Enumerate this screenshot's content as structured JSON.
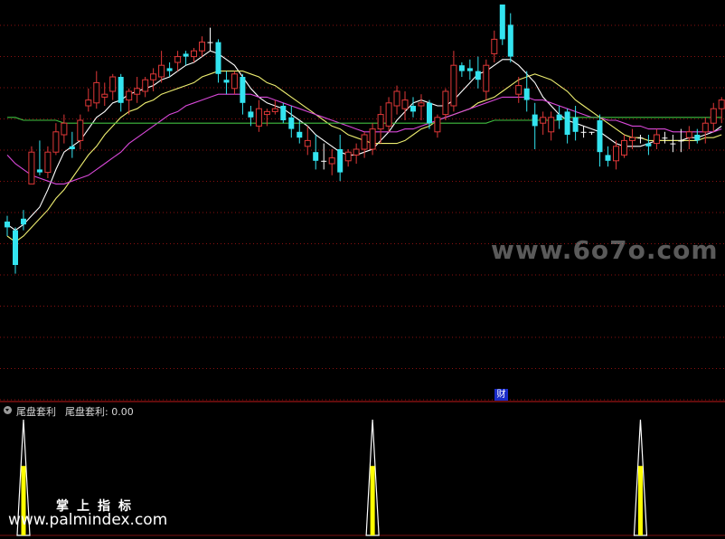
{
  "watermarks": {
    "site_6070": "www.6o7o.com",
    "brand_cn": "掌上指标",
    "url": "www.palmindex.com"
  },
  "badge": {
    "cai": "财"
  },
  "indicator": {
    "title": "尾盘套利",
    "value_label": "尾盘套利: 0.00"
  },
  "colors": {
    "background": "#000000",
    "grid": "#8a1010",
    "up": "#e03838",
    "down": "#33e4f0",
    "flat": "#ffffff",
    "ma5": "#ffffff",
    "ma10": "#eded70",
    "ma20": "#d848d8",
    "ma60": "#40c040",
    "signal_fill": "#ffff00",
    "signal_outline": "#ffffff"
  },
  "chart_data": [
    {
      "type": "candlestick",
      "title": "",
      "price_range": [
        0,
        100
      ],
      "grid": true,
      "series": [
        {
          "name": "",
          "key": "ma5"
        },
        {
          "name": "",
          "key": "ma10"
        },
        {
          "name": "",
          "key": "ma20"
        },
        {
          "name": "",
          "key": "ma60"
        }
      ],
      "ohlc": [
        [
          25,
          27,
          20,
          23
        ],
        [
          22,
          23,
          7,
          10
        ],
        [
          26,
          29,
          22,
          24
        ],
        [
          38,
          51,
          38,
          49
        ],
        [
          43,
          53,
          41,
          42
        ],
        [
          42,
          51,
          40,
          49
        ],
        [
          49,
          59,
          48,
          56
        ],
        [
          55,
          62,
          52,
          59
        ],
        [
          51,
          56,
          47,
          50
        ],
        [
          53,
          62,
          50,
          60
        ],
        [
          65,
          71,
          63,
          67
        ],
        [
          66,
          77,
          64,
          73
        ],
        [
          68,
          73,
          65,
          69
        ],
        [
          70,
          76,
          67,
          75
        ],
        [
          75,
          76,
          63,
          66
        ],
        [
          67,
          71,
          62,
          70
        ],
        [
          69,
          75,
          66,
          71
        ],
        [
          70,
          75,
          68,
          74
        ],
        [
          74,
          78,
          70,
          76
        ],
        [
          75,
          84,
          73,
          79
        ],
        [
          78,
          80,
          75,
          77
        ],
        [
          80,
          84,
          77,
          82
        ],
        [
          83,
          84,
          79,
          82
        ],
        [
          82,
          85,
          80,
          84
        ],
        [
          84,
          89,
          82,
          87
        ],
        [
          87,
          92,
          84,
          87
        ],
        [
          87,
          88,
          73,
          76
        ],
        [
          74,
          77,
          69,
          73
        ],
        [
          71,
          77,
          69,
          76
        ],
        [
          75,
          76,
          62,
          66
        ],
        [
          63,
          65,
          58,
          61
        ],
        [
          58,
          67,
          56,
          64
        ],
        [
          62,
          64,
          58,
          63
        ],
        [
          63,
          67,
          62,
          64
        ],
        [
          65,
          66,
          59,
          60
        ],
        [
          61,
          65,
          54,
          57
        ],
        [
          56,
          60,
          52,
          54
        ],
        [
          51,
          58,
          48,
          53
        ],
        [
          49,
          55,
          43,
          46
        ],
        [
          46,
          52,
          43,
          46
        ],
        [
          45,
          50,
          41,
          47
        ],
        [
          50,
          55,
          39,
          42
        ],
        [
          46,
          50,
          44,
          49
        ],
        [
          48,
          52,
          45,
          50
        ],
        [
          50,
          56,
          47,
          55
        ],
        [
          50,
          59,
          48,
          57
        ],
        [
          57,
          65,
          52,
          62
        ],
        [
          58,
          68,
          56,
          66
        ],
        [
          65,
          72,
          62,
          70
        ],
        [
          64,
          70,
          60,
          67
        ],
        [
          65,
          68,
          61,
          63
        ],
        [
          65,
          69,
          60,
          66
        ],
        [
          66,
          67,
          57,
          59
        ],
        [
          56,
          62,
          54,
          61
        ],
        [
          62,
          71,
          60,
          70
        ],
        [
          65,
          84,
          63,
          79
        ],
        [
          79,
          80,
          75,
          77
        ],
        [
          78,
          81,
          74,
          77
        ],
        [
          77,
          82,
          71,
          74
        ],
        [
          70,
          81,
          67,
          79
        ],
        [
          83,
          91,
          80,
          88
        ],
        [
          100,
          100,
          86,
          88
        ],
        [
          93,
          97,
          80,
          82
        ],
        [
          69,
          75,
          66,
          72
        ],
        [
          71,
          77,
          63,
          67
        ],
        [
          62,
          66,
          50,
          58
        ],
        [
          59,
          63,
          55,
          61
        ],
        [
          56,
          63,
          53,
          61
        ],
        [
          62,
          65,
          57,
          60
        ],
        [
          63,
          64,
          52,
          55
        ],
        [
          61,
          65,
          53,
          56
        ],
        [
          56,
          58,
          54,
          56
        ],
        [
          56,
          56,
          55,
          56
        ],
        [
          60,
          62,
          44,
          49
        ],
        [
          48,
          51,
          44,
          46
        ],
        [
          46,
          53,
          43,
          51
        ],
        [
          48,
          55,
          47,
          53
        ],
        [
          53,
          57,
          50,
          54
        ],
        [
          54,
          55,
          52,
          54
        ],
        [
          52,
          55,
          48,
          51
        ],
        [
          52,
          57,
          50,
          55
        ],
        [
          54,
          56,
          52,
          54
        ],
        [
          52,
          55,
          49,
          52
        ],
        [
          53,
          57,
          49,
          53
        ],
        [
          54,
          58,
          50,
          56
        ],
        [
          55,
          57,
          52,
          53
        ],
        [
          56,
          61,
          52,
          59
        ],
        [
          59,
          66,
          56,
          64
        ],
        [
          64,
          68,
          59,
          67
        ]
      ],
      "ma5": [
        24,
        22,
        24,
        27,
        30,
        36,
        43,
        49,
        51,
        53,
        57,
        61,
        63,
        66,
        67,
        69,
        70,
        71,
        72,
        74,
        75,
        77,
        79,
        80,
        82,
        84,
        83,
        81,
        79,
        75,
        71,
        68,
        66,
        65,
        64,
        62,
        60,
        58,
        55,
        53,
        51,
        49,
        48,
        48,
        49,
        50,
        53,
        56,
        60,
        63,
        66,
        67,
        66,
        65,
        65,
        67,
        70,
        73,
        76,
        77,
        79,
        81,
        81,
        79,
        76,
        73,
        68,
        65,
        62,
        60,
        59,
        58,
        57,
        56,
        54,
        52,
        51,
        51,
        51,
        52,
        53,
        53,
        53,
        53,
        54,
        54,
        55,
        56,
        58
      ],
      "ma10": [
        20,
        18,
        20,
        23,
        26,
        29,
        33,
        36,
        40,
        44,
        48,
        51,
        55,
        58,
        61,
        63,
        64,
        66,
        67,
        69,
        70,
        71,
        72,
        73,
        75,
        76,
        77,
        77,
        77,
        77,
        76,
        75,
        73,
        72,
        70,
        68,
        66,
        64,
        62,
        60,
        58,
        57,
        55,
        54,
        53,
        52,
        52,
        52,
        52,
        53,
        55,
        57,
        58,
        60,
        61,
        62,
        63,
        64,
        66,
        67,
        68,
        70,
        72,
        74,
        75,
        76,
        75,
        74,
        72,
        70,
        67,
        65,
        63,
        61,
        59,
        57,
        55,
        54,
        54,
        53,
        53,
        53,
        53,
        53,
        53,
        53,
        54,
        54,
        55
      ],
      "ma20": [
        48,
        45,
        43,
        41,
        40,
        39,
        38,
        38,
        39,
        40,
        41,
        43,
        45,
        47,
        49,
        52,
        54,
        56,
        58,
        60,
        62,
        63,
        65,
        66,
        67,
        68,
        69,
        69,
        69,
        69,
        69,
        68,
        68,
        67,
        66,
        65,
        64,
        63,
        62,
        61,
        60,
        59,
        58,
        57,
        56,
        56,
        56,
        56,
        56,
        57,
        57,
        58,
        59,
        60,
        61,
        62,
        63,
        64,
        65,
        66,
        67,
        68,
        68,
        68,
        68,
        67,
        67,
        66,
        65,
        64,
        63,
        62,
        61,
        61,
        60,
        60,
        59,
        58,
        58,
        57,
        57,
        57,
        56,
        56,
        56,
        56,
        56,
        56,
        57
      ],
      "ma60": [
        61,
        61,
        60,
        60,
        60,
        60,
        60,
        59,
        59,
        59,
        59,
        59,
        59,
        59,
        59,
        59,
        59,
        59,
        59,
        59,
        59,
        59,
        59,
        59,
        59,
        59,
        59,
        59,
        59,
        59,
        59,
        59,
        59,
        59,
        59,
        59,
        59,
        59,
        59,
        59,
        59,
        59,
        59,
        59,
        59,
        59,
        59,
        59,
        59,
        59,
        59,
        59,
        59,
        59,
        59,
        59,
        59,
        59,
        59,
        59,
        60,
        60,
        60,
        60,
        60,
        60,
        60,
        60,
        60,
        61,
        61,
        61,
        61,
        61,
        61,
        61,
        61,
        61,
        61,
        61,
        61,
        61,
        61,
        61,
        61,
        61,
        61,
        61,
        61
      ]
    },
    {
      "type": "bar",
      "title": "尾盘套利",
      "ylim": [
        0,
        1
      ],
      "signals": [
        {
          "bar_index": 1,
          "value": 1
        },
        {
          "bar_index": 44,
          "value": 1
        },
        {
          "bar_index": 77,
          "value": 1
        }
      ]
    }
  ]
}
